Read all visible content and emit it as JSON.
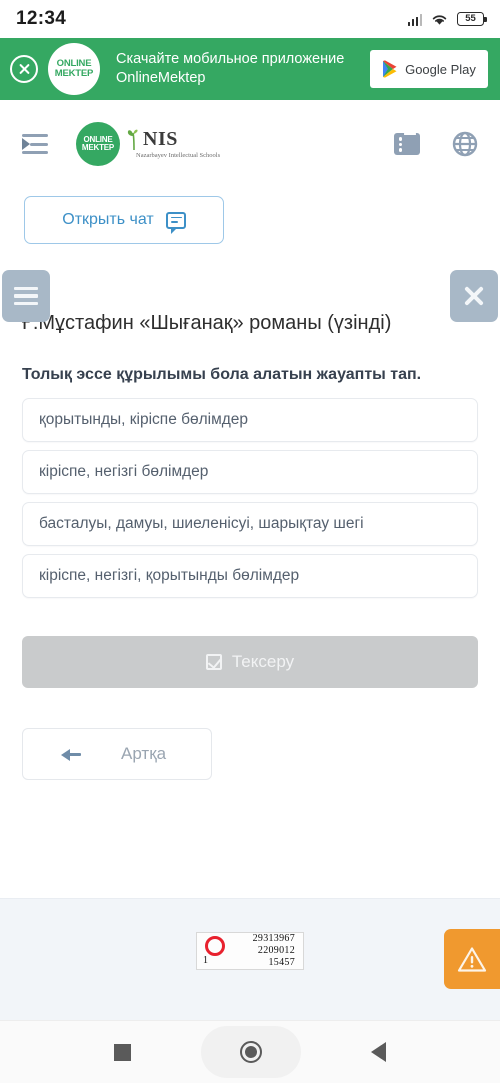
{
  "statusbar": {
    "time": "12:34",
    "battery_level": "55",
    "signal_icon": "signal-bars-icon",
    "wifi_icon": "wifi-icon",
    "battery_icon": "battery-icon"
  },
  "app_banner": {
    "close_icon": "close-circle-icon",
    "logo_line1": "ONLINE",
    "logo_line2": "MEKTEP",
    "text": "Скачайте мобильное приложение OnlineMektep",
    "store_button_label": "Google Play",
    "store_icon": "google-play-icon",
    "background_color": "#35a862"
  },
  "site_header": {
    "menu_icon": "indent-menu-icon",
    "brand_om_line1": "ONLINE",
    "brand_om_line2": "MEKTEP",
    "brand_nis": "NIS",
    "brand_nis_sub": "Nazarbayev Intellectual Schools",
    "list_icon": "list-view-icon",
    "globe_icon": "globe-language-icon",
    "icon_color": "#8fa0b4"
  },
  "chat": {
    "label": "Открыть чат",
    "icon": "chat-bubble-icon",
    "accent_color": "#3d90c7"
  },
  "lesson": {
    "menu_button_icon": "hamburger-icon",
    "close_button_icon": "close-x-icon",
    "toolbar_color": "#a8b8c7",
    "title": "Ғ.Мұстафин «Шығанақ» романы (үзінді)",
    "question": "Толық эссе құрылымы бола алатын жауапты тап.",
    "options": [
      "қорытынды, кіріспе бөлімдер",
      "кіріспе, негізгі бөлімдер",
      "басталуы, дамуы, шиеленісуі, шарықтау шегі",
      "кіріспе, негізгі, қорытынды бөлімдер"
    ],
    "check_label": "Тексеру",
    "check_icon": "checkbox-checked-icon",
    "check_disabled_color": "#c9cbcc",
    "back_label": "Артқа",
    "back_icon": "arrow-left-icon"
  },
  "footer": {
    "counter": {
      "circle_icon": "red-circle-icon",
      "circle_color": "#e8212e",
      "rank": "1",
      "values": [
        "29313967",
        "2209012",
        "15457"
      ]
    },
    "warning_fab": {
      "icon": "warning-triangle-icon",
      "color": "#f0992f"
    }
  },
  "navbar": {
    "recents_icon": "recents-square-icon",
    "home_icon": "home-circle-icon",
    "back_icon": "back-triangle-icon"
  }
}
